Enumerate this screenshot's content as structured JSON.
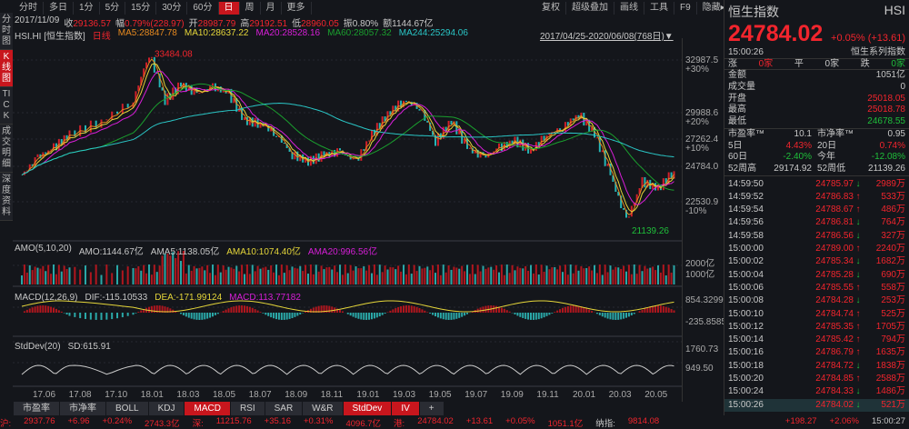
{
  "topbar": {
    "periods": [
      "分时",
      "多日",
      "1分",
      "5分",
      "15分",
      "30分",
      "60分",
      "日",
      "周",
      "月",
      "更多"
    ],
    "active": "日",
    "tools": [
      "复权",
      "超级叠加",
      "画线",
      "工具",
      "F9",
      "隐藏▸"
    ]
  },
  "sidebar": [
    "分时图",
    "K线图",
    "TICK",
    "成交明细",
    "深度资料"
  ],
  "info": {
    "date": "2017/11/09",
    "close_label": "收",
    "close": "29136.57",
    "chg_label": "幅",
    "chg": "0.79%(228.97)",
    "open_label": "开",
    "open": "28987.79",
    "high_label": "高",
    "high": "29192.51",
    "low_label": "低",
    "low": "28960.05",
    "amp": "振0.80%",
    "amount": "额1144.67亿"
  },
  "legend": {
    "name": "HSI.HI [恒生指数]",
    "period": "日线",
    "ma5": "MA5:28847.78",
    "ma10": "MA10:28637.22",
    "ma20": "MA20:28528.16",
    "ma60": "MA60:28057.32",
    "ma244": "MA244:25294.06",
    "range": "2017/04/25-2020/06/08(768日)▼"
  },
  "price_axis": [
    {
      "v": "32987.5",
      "p": "+30%"
    },
    {
      "v": "29988.6",
      "p": "+20%"
    },
    {
      "v": "27262.4",
      "p": "+10%"
    },
    {
      "v": "24784.0",
      "p": ""
    },
    {
      "v": "22530.9",
      "p": "-10%"
    }
  ],
  "annotations": {
    "high": "33484.08",
    "low": "21139.26"
  },
  "amo": {
    "title": "AMO(5,10,20)",
    "amo": "AMO:1144.67亿",
    "ama5": "AMA5:1138.05亿",
    "ama10": "AMA10:1074.40亿",
    "ama20": "AMA20:996.56亿",
    "axis": [
      "2000亿",
      "1000亿"
    ]
  },
  "macd": {
    "title": "MACD(12,26,9)",
    "dif": "DIF:-115.10533",
    "dea": "DEA:-171.99124",
    "macd": "MACD:113.77182",
    "axis": [
      "854.3299",
      "-235.8585"
    ]
  },
  "stddev": {
    "title": "StdDev(20)",
    "sd": "SD:615.91",
    "axis": [
      "1760.73",
      "949.50"
    ]
  },
  "dates": [
    "17.06",
    "17.08",
    "17.10",
    "18.01",
    "18.03",
    "18.05",
    "18.07",
    "18.09",
    "18.11",
    "19.01",
    "19.03",
    "19.05",
    "19.07",
    "19.09",
    "19.11",
    "20.01",
    "20.03",
    "20.05"
  ],
  "tabs": [
    "市盈率",
    "市净率",
    "BOLL",
    "KDJ",
    "MACD",
    "RSI",
    "SAR",
    "W&R",
    "StdDev",
    "IV",
    "+"
  ],
  "active_tabs": [
    "MACD",
    "StdDev",
    "IV"
  ],
  "quote": {
    "name": "恒生指数",
    "code": "HSI",
    "price": "24784.02",
    "change": "+0.05% (+13.61)",
    "time": "15:00:26",
    "series": "恒生系列指数",
    "breadth": {
      "up_label": "涨",
      "up": "0家",
      "flat_label": "平",
      "flat": "0家",
      "down_label": "跌",
      "down": "0家"
    },
    "stats": [
      {
        "k": "金额",
        "v": "1051亿",
        "c": "w"
      },
      {
        "k": "成交量",
        "v": "0",
        "c": "w"
      },
      {
        "k": "开盘",
        "v": "25018.05",
        "c": "r"
      },
      {
        "k": "最高",
        "v": "25018.78",
        "c": "r"
      },
      {
        "k": "最低",
        "v": "24678.55",
        "c": "g"
      }
    ],
    "ratios": [
      {
        "k1": "市盈率™",
        "v1": "10.1",
        "c1": "w",
        "k2": "市净率™",
        "v2": "0.95",
        "c2": "w"
      },
      {
        "k1": "5日",
        "v1": "4.43%",
        "c1": "r",
        "k2": "20日",
        "v2": "0.74%",
        "c2": "r"
      },
      {
        "k1": "60日",
        "v1": "-2.40%",
        "c1": "g",
        "k2": "今年",
        "v2": "-12.08%",
        "c2": "g"
      },
      {
        "k1": "52周高",
        "v1": "29174.92",
        "c1": "w",
        "k2": "52周低",
        "v2": "21139.26",
        "c2": "w"
      }
    ]
  },
  "ticks": [
    [
      "14:59:50",
      "24785.97",
      "down",
      "2989万"
    ],
    [
      "14:59:52",
      "24786.83",
      "up",
      "533万"
    ],
    [
      "14:59:54",
      "24788.67",
      "up",
      "486万"
    ],
    [
      "14:59:56",
      "24786.81",
      "down",
      "764万"
    ],
    [
      "14:59:58",
      "24786.56",
      "down",
      "327万"
    ],
    [
      "15:00:00",
      "24789.00",
      "up",
      "2240万"
    ],
    [
      "15:00:02",
      "24785.34",
      "down",
      "1682万"
    ],
    [
      "15:00:04",
      "24785.28",
      "down",
      "690万"
    ],
    [
      "15:00:06",
      "24785.55",
      "up",
      "558万"
    ],
    [
      "15:00:08",
      "24784.28",
      "down",
      "253万"
    ],
    [
      "15:00:10",
      "24784.74",
      "up",
      "525万"
    ],
    [
      "15:00:12",
      "24785.35",
      "up",
      "1705万"
    ],
    [
      "15:00:14",
      "24785.42",
      "up",
      "794万"
    ],
    [
      "15:00:16",
      "24786.79",
      "up",
      "1635万"
    ],
    [
      "15:00:18",
      "24784.72",
      "down",
      "1838万"
    ],
    [
      "15:00:20",
      "24784.85",
      "up",
      "2588万"
    ],
    [
      "15:00:24",
      "24784.33",
      "down",
      "1486万"
    ],
    [
      "15:00:26",
      "24784.02",
      "down",
      "521万"
    ]
  ],
  "status": {
    "sh": [
      "沪:",
      "2937.76",
      "+6.96",
      "+0.24%",
      "2743.3亿"
    ],
    "sz": [
      "深:",
      "11215.76",
      "+35.16",
      "+0.31%",
      "4096.7亿"
    ],
    "hk": [
      "港:",
      "24784.02",
      "+13.61",
      "+0.05%",
      "1051.1亿"
    ],
    "nas": [
      "纳指:",
      "9814.08"
    ],
    "right": [
      "+198.27",
      "+2.06%",
      "15:00:27"
    ]
  },
  "price_series": [
    [
      0,
      24500
    ],
    [
      1,
      25800
    ],
    [
      2,
      26500
    ],
    [
      3,
      27500
    ],
    [
      5,
      28500
    ],
    [
      7,
      30000
    ],
    [
      8,
      33484
    ],
    [
      9,
      30000
    ],
    [
      10,
      31200
    ],
    [
      11,
      30500
    ],
    [
      12,
      31000
    ],
    [
      13,
      30500
    ],
    [
      14,
      28500
    ],
    [
      15,
      28300
    ],
    [
      16,
      27500
    ],
    [
      17,
      26000
    ],
    [
      18,
      25500
    ],
    [
      19,
      26000
    ],
    [
      20,
      26200
    ],
    [
      21,
      25500
    ],
    [
      22,
      27500
    ],
    [
      23,
      29000
    ],
    [
      24,
      30000
    ],
    [
      25,
      29500
    ],
    [
      26,
      27000
    ],
    [
      27,
      28500
    ],
    [
      28,
      26500
    ],
    [
      29,
      25800
    ],
    [
      30,
      26500
    ],
    [
      31,
      27000
    ],
    [
      32,
      26300
    ],
    [
      33,
      27500
    ],
    [
      34,
      28000
    ],
    [
      35,
      29000
    ],
    [
      36,
      27500
    ],
    [
      37,
      24500
    ],
    [
      38,
      21139
    ],
    [
      39,
      24000
    ],
    [
      40,
      23500
    ],
    [
      41,
      24784
    ]
  ],
  "colors": {
    "up": "#f2252d",
    "down": "#1fbf3a",
    "accent": "#c8161d"
  }
}
